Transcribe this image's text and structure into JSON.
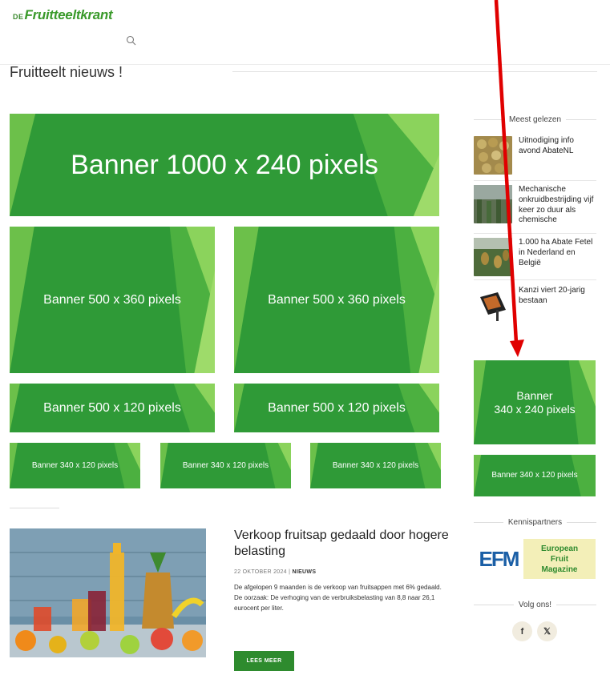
{
  "header": {
    "logo_prefix": "DE",
    "logo_name": "Fruitteeltkrant",
    "search_icon": "search-icon"
  },
  "page": {
    "title": "Fruitteelt nieuws !"
  },
  "banners": {
    "top": "Banner 1000 x 240 pixels",
    "mid_left": "Banner 500 x 360 pixels",
    "mid_right": "Banner 500 x 360 pixels",
    "small_left": "Banner 500 x 120 pixels",
    "small_right": "Banner 500 x 120 pixels",
    "tiny_1": "Banner 340 x 120 pixels",
    "tiny_2": "Banner 340 x 120 pixels",
    "tiny_3": "Banner 340 x 120 pixels",
    "side_large_1": "Banner",
    "side_large_2": "340 x 240 pixels",
    "side_small": "Banner 340 x 120 pixels"
  },
  "sidebar": {
    "most_read_heading": "Meest gelezen",
    "most_read": [
      {
        "title": "Uitnodiging info avond AbateNL"
      },
      {
        "title": "Mechanische onkruidbestrijding vijf keer zo duur als chemische"
      },
      {
        "title": "1.000 ha Abate Fetel in Nederland en België"
      },
      {
        "title": "Kanzi viert 20-jarig bestaan"
      }
    ],
    "partners_heading": "Kennispartners",
    "partner_logo_text": "EFM",
    "partner_line1": "European",
    "partner_line2": "Fruit",
    "partner_line3": "Magazine",
    "follow_heading": "Volg ons!",
    "social": [
      "f",
      "𝕏"
    ]
  },
  "article": {
    "title": "Verkoop fruitsap gedaald door hogere belasting",
    "date": "22 OKTOBER 2024",
    "category": "NIEUWS",
    "excerpt": "De afgelopen 9 maanden is de verkoop van fruitsappen met 6% gedaald. De oorzaak: De verhoging van de verbruiksbelasting van 8,8 naar 26,1 eurocent per liter.",
    "button": "LEES MEER"
  },
  "colors": {
    "brand_green": "#3a9a2b",
    "banner_green": "#2f9a37",
    "button_green": "#2e8b2e",
    "annotation_arrow": "#e00000"
  }
}
